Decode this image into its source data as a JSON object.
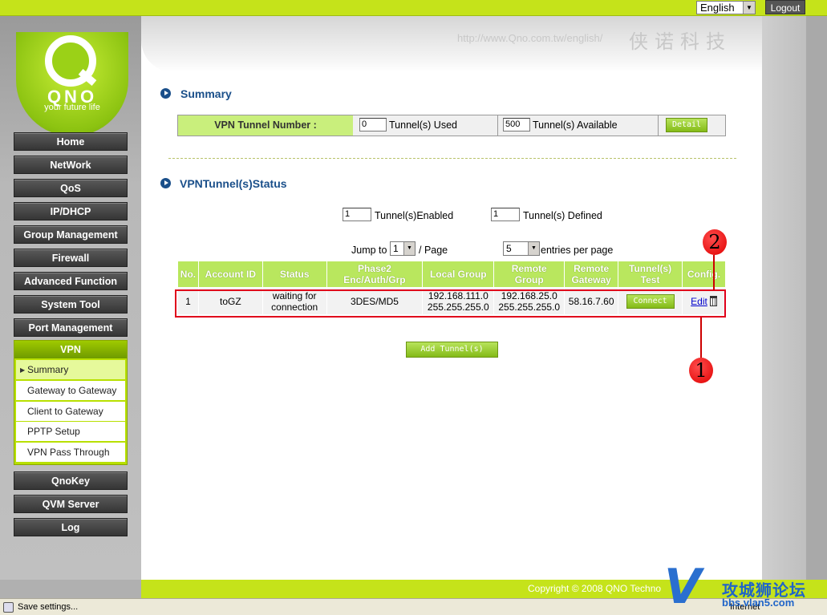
{
  "topbar": {
    "language": "English",
    "logout": "Logout"
  },
  "header": {
    "url": "http://www.Qno.com.tw/english/",
    "cn_title": "侠诺科技"
  },
  "logo": {
    "brand": "QNO",
    "slogan": "your future life"
  },
  "nav": {
    "items": [
      "Home",
      "NetWork",
      "QoS",
      "IP/DHCP",
      "Group Management",
      "Firewall",
      "Advanced Function",
      "System Tool",
      "Port Management"
    ],
    "vpn": {
      "label": "VPN",
      "subitems": [
        "Summary",
        "Gateway to Gateway",
        "Client to Gateway",
        "PPTP Setup",
        "VPN Pass Through"
      ]
    },
    "bottom_items": [
      "QnoKey",
      "QVM Server",
      "Log"
    ]
  },
  "summary": {
    "title": "Summary",
    "tunnel_number_label": "VPN Tunnel Number :",
    "used_value": "0",
    "used_label": "Tunnel(s) Used",
    "available_value": "500",
    "available_label": "Tunnel(s) Available",
    "detail_button": "Detail"
  },
  "status": {
    "title": "VPNTunnel(s)Status",
    "enabled_value": "1",
    "enabled_label": "Tunnel(s)Enabled",
    "defined_value": "1",
    "defined_label": "Tunnel(s) Defined",
    "jump_to_label": "Jump to",
    "page_value": "1",
    "page_label": "/  Page",
    "entries_value": "5",
    "entries_label": "entries per page"
  },
  "table": {
    "headers": [
      "No.",
      "Account ID",
      "Status",
      "Phase2\nEnc/Auth/Grp",
      "Local Group",
      "Remote\nGroup",
      "Remote\nGateway",
      "Tunnel(s)\nTest",
      "Config."
    ],
    "rows": [
      {
        "no": "1",
        "account": "toGZ",
        "status_line1": "waiting for",
        "status_line2": "connection",
        "phase2": "3DES/MD5",
        "local_ip": "192.168.111.0",
        "local_mask": "255.255.255.0",
        "remote_ip": "192.168.25.0",
        "remote_mask": "255.255.255.0",
        "gateway": "58.16.7.60",
        "connect": "Connect",
        "edit": "Edit"
      }
    ]
  },
  "add_tunnel_button": "Add Tunnel(s)",
  "annotations": {
    "one": "1",
    "two": "2"
  },
  "footer": {
    "copyright": "Copyright © 2008 QNO Techno"
  },
  "statusbar": {
    "text": "Save settings...",
    "zone": "Internet"
  },
  "watermark": {
    "v": "V",
    "cn": "攻城狮论坛",
    "url": "bbs.vlan5.com"
  },
  "colors": {
    "accent_green": "#c5e31a",
    "header_green": "#b9e75e",
    "title_blue": "#1a4f8a",
    "highlight_red": "#e0001b"
  }
}
